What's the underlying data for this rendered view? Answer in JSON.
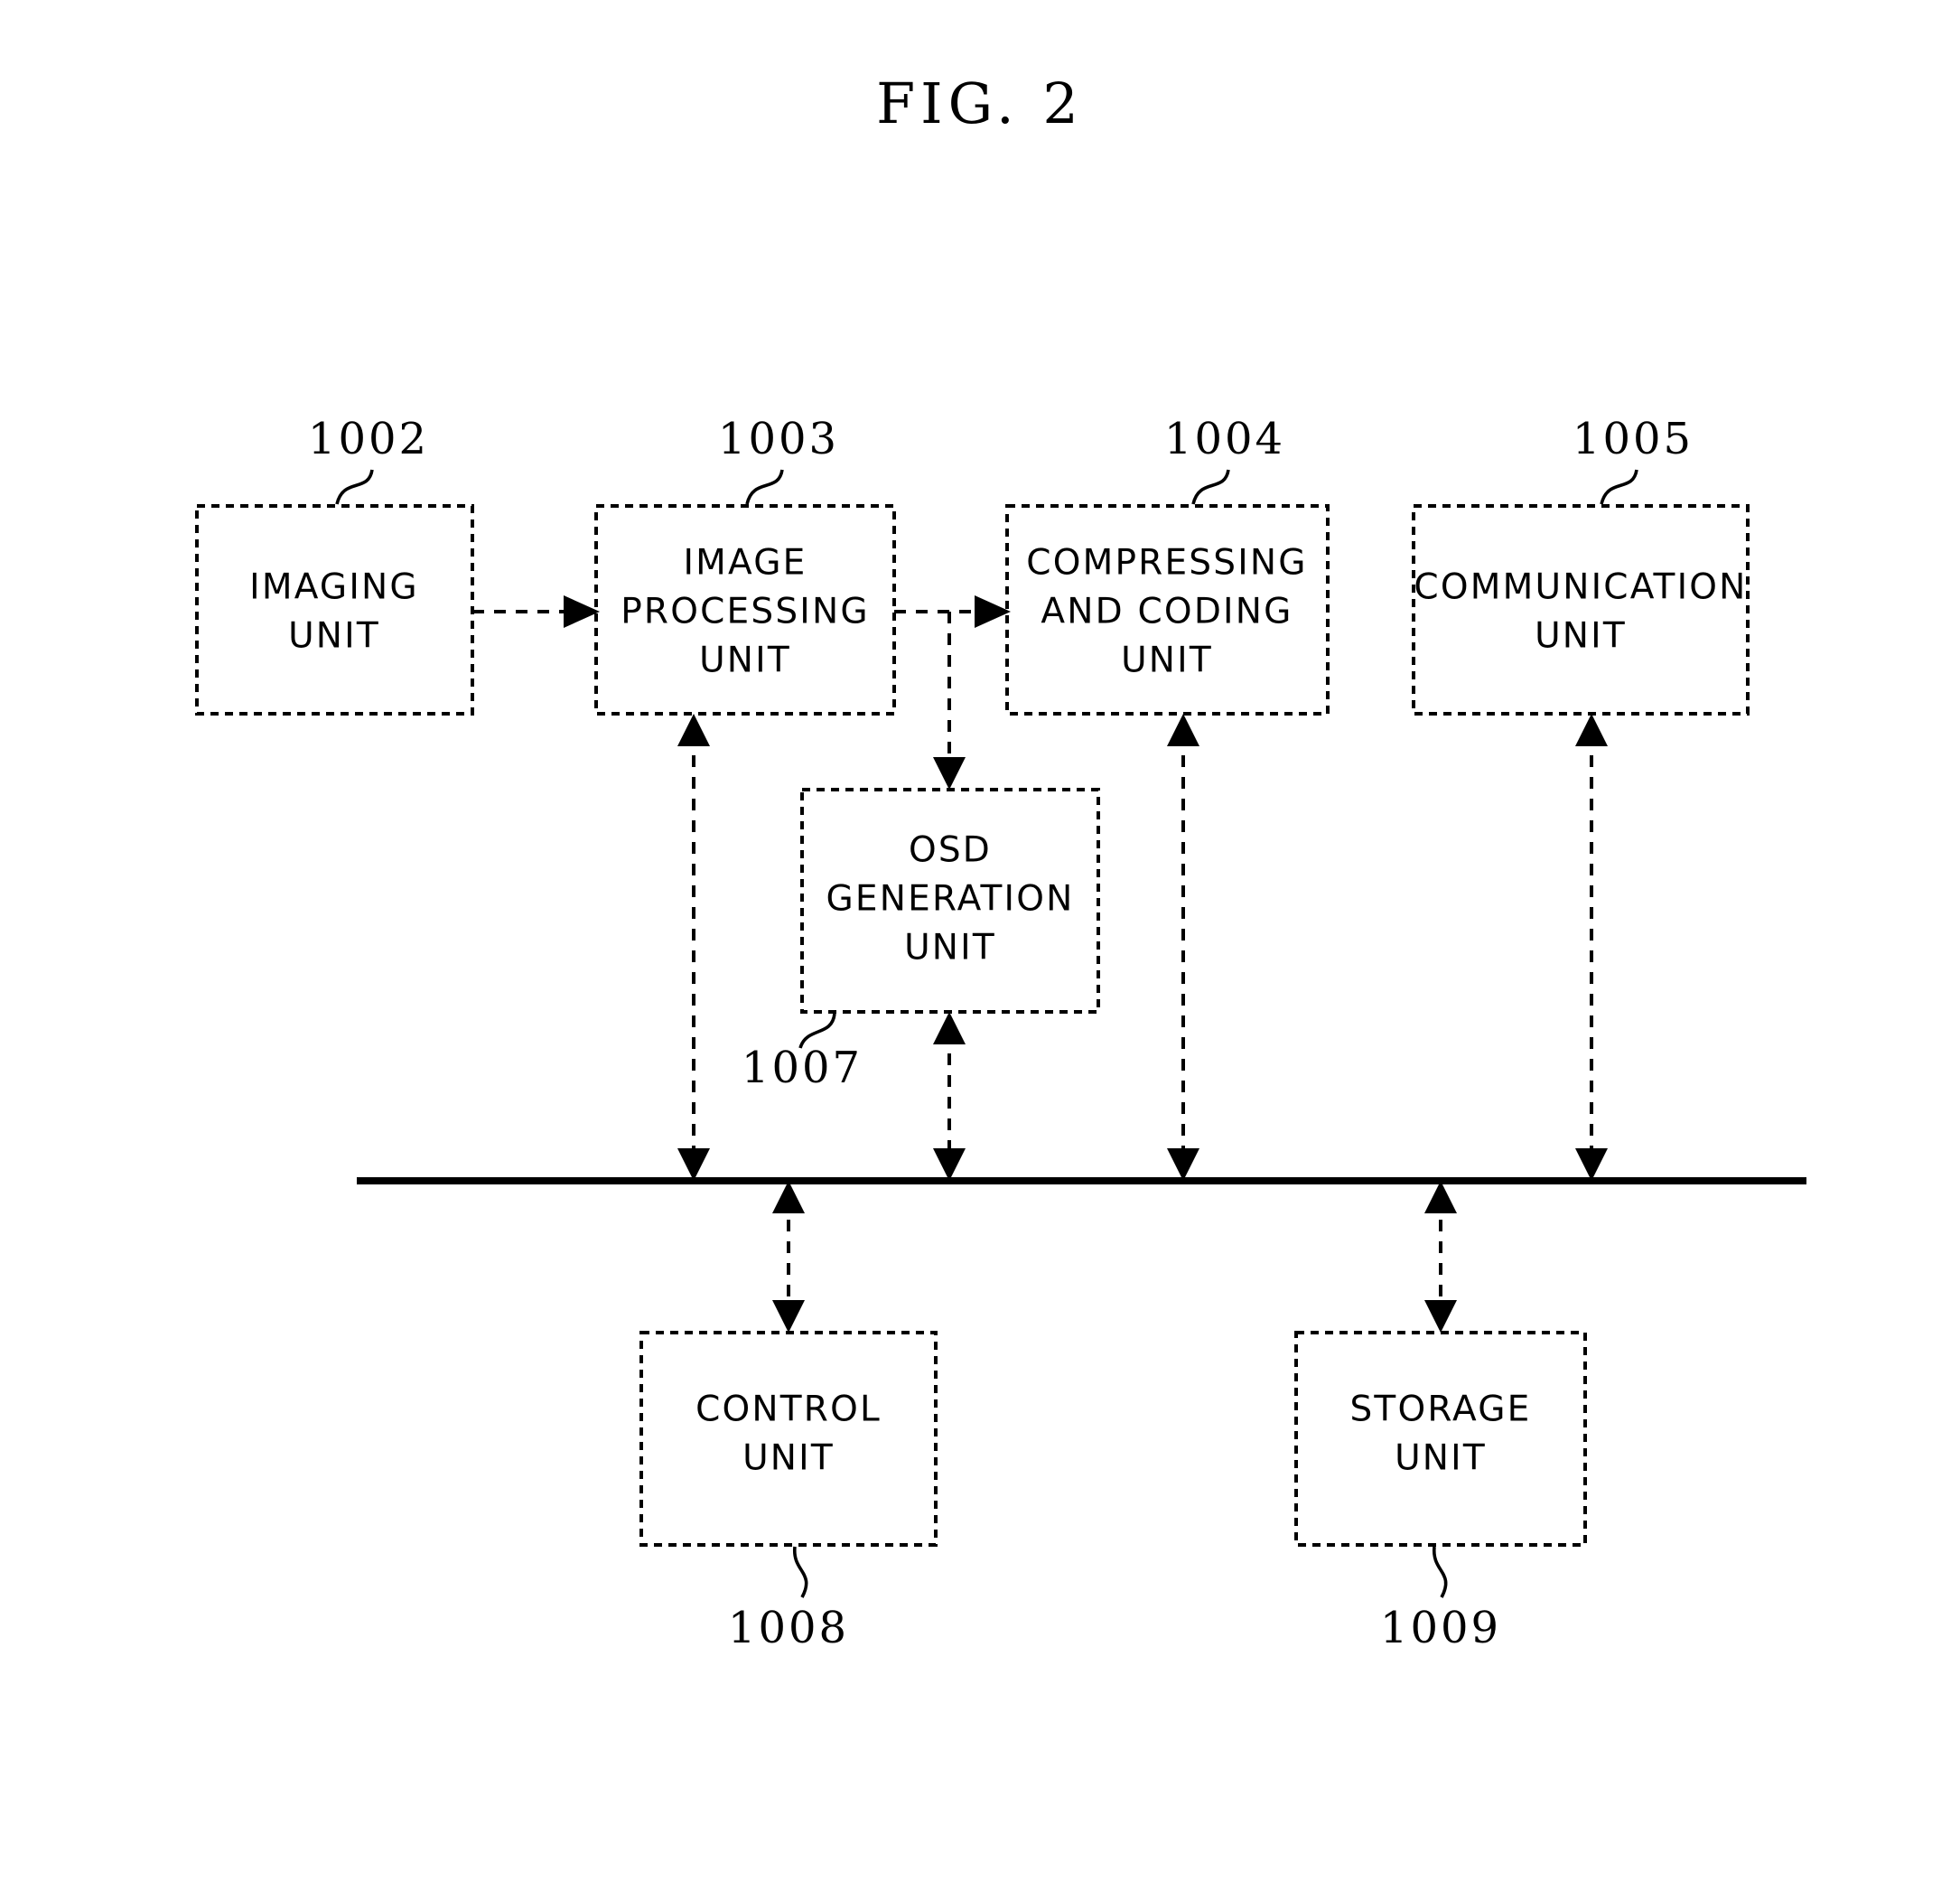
{
  "figure": {
    "title": "FIG. 2",
    "type": "patent-block-diagram"
  },
  "blocks": [
    {
      "id": "imaging",
      "ref": "1002",
      "label_lines": [
        "IMAGING",
        "UNIT"
      ]
    },
    {
      "id": "image_proc",
      "ref": "1003",
      "label_lines": [
        "IMAGE",
        "PROCESSING",
        "UNIT"
      ]
    },
    {
      "id": "compressing",
      "ref": "1004",
      "label_lines": [
        "COMPRESSING",
        "AND  CODING",
        "UNIT"
      ]
    },
    {
      "id": "communication",
      "ref": "1005",
      "label_lines": [
        "COMMUNICATION",
        "UNIT"
      ]
    },
    {
      "id": "osd",
      "ref": "1007",
      "label_lines": [
        "OSD",
        "GENERATION",
        "UNIT"
      ]
    },
    {
      "id": "control",
      "ref": "1008",
      "label_lines": [
        "CONTROL",
        "UNIT"
      ]
    },
    {
      "id": "storage",
      "ref": "1009",
      "label_lines": [
        "STORAGE",
        "UNIT"
      ]
    }
  ],
  "connections": [
    {
      "from": "imaging",
      "to": "image_proc",
      "style": "dashed",
      "arrows": "single"
    },
    {
      "from": "image_proc",
      "to": "compressing",
      "style": "dashed",
      "arrows": "single"
    },
    {
      "from": "image_proc",
      "to": "osd",
      "style": "dashed",
      "arrows": "single"
    },
    {
      "from": "osd",
      "to": "bus",
      "style": "dashed",
      "arrows": "double"
    },
    {
      "from": "image_proc",
      "to": "bus",
      "style": "dashed",
      "arrows": "double"
    },
    {
      "from": "compressing",
      "to": "bus",
      "style": "dashed",
      "arrows": "double"
    },
    {
      "from": "communication",
      "to": "bus",
      "style": "dashed",
      "arrows": "double"
    },
    {
      "from": "bus",
      "to": "control",
      "style": "dashed",
      "arrows": "double"
    },
    {
      "from": "bus",
      "to": "storage",
      "style": "dashed",
      "arrows": "double"
    }
  ],
  "bus": {
    "name": "system-bus"
  },
  "colors": {
    "ink": "#000000",
    "paper": "#ffffff"
  }
}
